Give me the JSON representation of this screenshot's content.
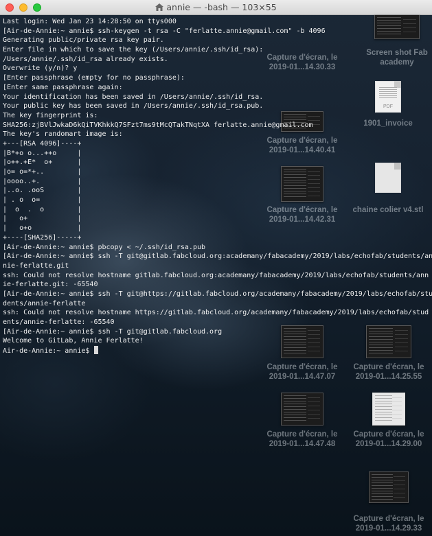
{
  "window": {
    "title": "annie — -bash — 103×55"
  },
  "terminal": {
    "lines": [
      "Last login: Wed Jan 23 14:28:50 on ttys000",
      "[Air-de-Annie:~ annie$ ssh-keygen -t rsa -C \"ferlatte.annie@gmail.com\" -b 4096",
      "Generating public/private rsa key pair.",
      "Enter file in which to save the key (/Users/annie/.ssh/id_rsa):",
      "/Users/annie/.ssh/id_rsa already exists.",
      "Overwrite (y/n)? y",
      "[Enter passphrase (empty for no passphrase):",
      "[Enter same passphrase again:",
      "Your identification has been saved in /Users/annie/.ssh/id_rsa.",
      "Your public key has been saved in /Users/annie/.ssh/id_rsa.pub.",
      "The key fingerprint is:",
      "SHA256:zjBVlJwkaD6kQiTVKhkkQ7SFzt7ms9tMcQTakTNqtXA ferlatte.annie@gmail.com",
      "The key's randomart image is:",
      "+---[RSA 4096]----+",
      "|B*+o o...++o     |",
      "|o++.+E*  o+      |",
      "|o= o=*+..        |",
      "|oooo..+.         |",
      "|..o. .ooS        |",
      "| . o  o=         |",
      "|  o  .  o        |",
      "|   o+            |",
      "|   o+o           |",
      "+----[SHA256]-----+",
      "[Air-de-Annie:~ annie$ pbcopy < ~/.ssh/id_rsa.pub",
      "[Air-de-Annie:~ annie$ ssh -T git@gitlab.fabcloud.org:academany/fabacademy/2019/labs/echofab/students/an",
      "nie-ferlatte.git",
      "ssh: Could not resolve hostname gitlab.fabcloud.org:academany/fabacademy/2019/labs/echofab/students/ann",
      "ie-ferlatte.git: -65540",
      "[Air-de-Annie:~ annie$ ssh -T git@https://gitlab.fabcloud.org/academany/fabacademy/2019/labs/echofab/stu",
      "dents/annie-ferlatte",
      "ssh: Could not resolve hostname https://gitlab.fabcloud.org/academany/fabacademy/2019/labs/echofab/stud",
      "ents/annie-ferlatte: -65540",
      "[Air-de-Annie:~ annie$ ssh -T git@gitlab.fabcloud.org",
      "Welcome to GitLab, Annie Ferlatte!",
      "Air-de-Annie:~ annie$ "
    ]
  },
  "desktop": {
    "icons": [
      {
        "line1": "Screen shot Fab",
        "line2": "academy"
      },
      {
        "line1": "Capture d'écran, le",
        "line2": "2019-01...14.30.33"
      },
      {
        "line1": "1901_invoice",
        "line2": "",
        "badge": "PDF"
      },
      {
        "line1": "Capture d'écran, le",
        "line2": "2019-01...14.40.41"
      },
      {
        "line1": "chaine colier v4.stl",
        "line2": ""
      },
      {
        "line1": "Capture d'écran, le",
        "line2": "2019-01...14.42.31"
      },
      {
        "line1": "Capture d'écran, le",
        "line2": "2019-01...14.47.07"
      },
      {
        "line1": "Capture d'écran, le",
        "line2": "2019-01...14.25.55"
      },
      {
        "line1": "Capture d'écran, le",
        "line2": "2019-01...14.47.48"
      },
      {
        "line1": "Capture d'écran, le",
        "line2": "2019-01...14.29.00"
      },
      {
        "line1": "Capture d'écran, le",
        "line2": "2019-01...14.29.33"
      }
    ]
  }
}
